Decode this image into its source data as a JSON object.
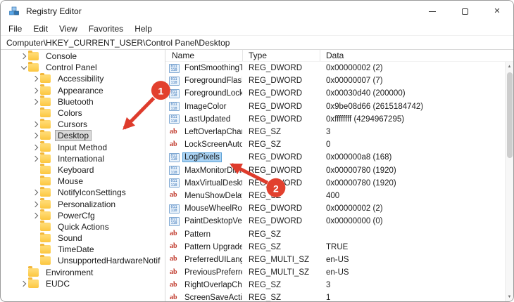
{
  "window": {
    "title": "Registry Editor"
  },
  "menu": {
    "items": [
      "File",
      "Edit",
      "View",
      "Favorites",
      "Help"
    ]
  },
  "address": {
    "path": "Computer\\HKEY_CURRENT_USER\\Control Panel\\Desktop"
  },
  "tree": {
    "items": [
      {
        "label": "Console",
        "level": 1,
        "chevron": "right"
      },
      {
        "label": "Control Panel",
        "level": 1,
        "chevron": "down"
      },
      {
        "label": "Accessibility",
        "level": 2,
        "chevron": "right"
      },
      {
        "label": "Appearance",
        "level": 2,
        "chevron": "right"
      },
      {
        "label": "Bluetooth",
        "level": 2,
        "chevron": "right"
      },
      {
        "label": "Colors",
        "level": 2,
        "chevron": "none"
      },
      {
        "label": "Cursors",
        "level": 2,
        "chevron": "right"
      },
      {
        "label": "Desktop",
        "level": 2,
        "chevron": "right",
        "selected": true
      },
      {
        "label": "Input Method",
        "level": 2,
        "chevron": "right"
      },
      {
        "label": "International",
        "level": 2,
        "chevron": "right"
      },
      {
        "label": "Keyboard",
        "level": 2,
        "chevron": "none"
      },
      {
        "label": "Mouse",
        "level": 2,
        "chevron": "none"
      },
      {
        "label": "NotifyIconSettings",
        "level": 2,
        "chevron": "right"
      },
      {
        "label": "Personalization",
        "level": 2,
        "chevron": "right"
      },
      {
        "label": "PowerCfg",
        "level": 2,
        "chevron": "right"
      },
      {
        "label": "Quick Actions",
        "level": 2,
        "chevron": "none"
      },
      {
        "label": "Sound",
        "level": 2,
        "chevron": "none"
      },
      {
        "label": "TimeDate",
        "level": 2,
        "chevron": "none"
      },
      {
        "label": "UnsupportedHardwareNotif",
        "level": 2,
        "chevron": "none"
      },
      {
        "label": "Environment",
        "level": 1,
        "chevron": "none"
      },
      {
        "label": "EUDC",
        "level": 1,
        "chevron": "right"
      }
    ]
  },
  "list": {
    "columns": [
      "Name",
      "Type",
      "Data"
    ],
    "rows": [
      {
        "name": "FontSmoothingT...",
        "type": "REG_DWORD",
        "data": "0x00000002 (2)",
        "icon": "dword"
      },
      {
        "name": "ForegroundFlash...",
        "type": "REG_DWORD",
        "data": "0x00000007 (7)",
        "icon": "dword"
      },
      {
        "name": "ForegroundLock...",
        "type": "REG_DWORD",
        "data": "0x00030d40 (200000)",
        "icon": "dword"
      },
      {
        "name": "ImageColor",
        "type": "REG_DWORD",
        "data": "0x9be08d66 (2615184742)",
        "icon": "dword"
      },
      {
        "name": "LastUpdated",
        "type": "REG_DWORD",
        "data": "0xffffffff (4294967295)",
        "icon": "dword"
      },
      {
        "name": "LeftOverlapChars",
        "type": "REG_SZ",
        "data": "3",
        "icon": "sz"
      },
      {
        "name": "LockScreenAutoL...",
        "type": "REG_SZ",
        "data": "0",
        "icon": "sz"
      },
      {
        "name": "LogPixels",
        "type": "REG_DWORD",
        "data": "0x000000a8 (168)",
        "icon": "dword",
        "selected": true
      },
      {
        "name": "MaxMonitorDim...",
        "type": "REG_DWORD",
        "data": "0x00000780 (1920)",
        "icon": "dword"
      },
      {
        "name": "MaxVirtualDeskt...",
        "type": "REG_DWORD",
        "data": "0x00000780 (1920)",
        "icon": "dword"
      },
      {
        "name": "MenuShowDelay",
        "type": "REG_SZ",
        "data": "400",
        "icon": "sz"
      },
      {
        "name": "MouseWheelRou...",
        "type": "REG_DWORD",
        "data": "0x00000002 (2)",
        "icon": "dword"
      },
      {
        "name": "PaintDesktopVer...",
        "type": "REG_DWORD",
        "data": "0x00000000 (0)",
        "icon": "dword"
      },
      {
        "name": "Pattern",
        "type": "REG_SZ",
        "data": "",
        "icon": "sz"
      },
      {
        "name": "Pattern Upgrade",
        "type": "REG_SZ",
        "data": "TRUE",
        "icon": "sz"
      },
      {
        "name": "PreferredUILang...",
        "type": "REG_MULTI_SZ",
        "data": "en-US",
        "icon": "sz"
      },
      {
        "name": "PreviousPreferre...",
        "type": "REG_MULTI_SZ",
        "data": "en-US",
        "icon": "sz"
      },
      {
        "name": "RightOverlapCha...",
        "type": "REG_SZ",
        "data": "3",
        "icon": "sz"
      },
      {
        "name": "ScreenSaveActive",
        "type": "REG_SZ",
        "data": "1",
        "icon": "sz"
      }
    ]
  },
  "annotations": {
    "step1": "1",
    "step2": "2"
  },
  "colors": {
    "annotation_red": "#de3b2c",
    "selection_blue": "#a9d2f3",
    "tree_selection_gray": "#d9d9d9"
  }
}
